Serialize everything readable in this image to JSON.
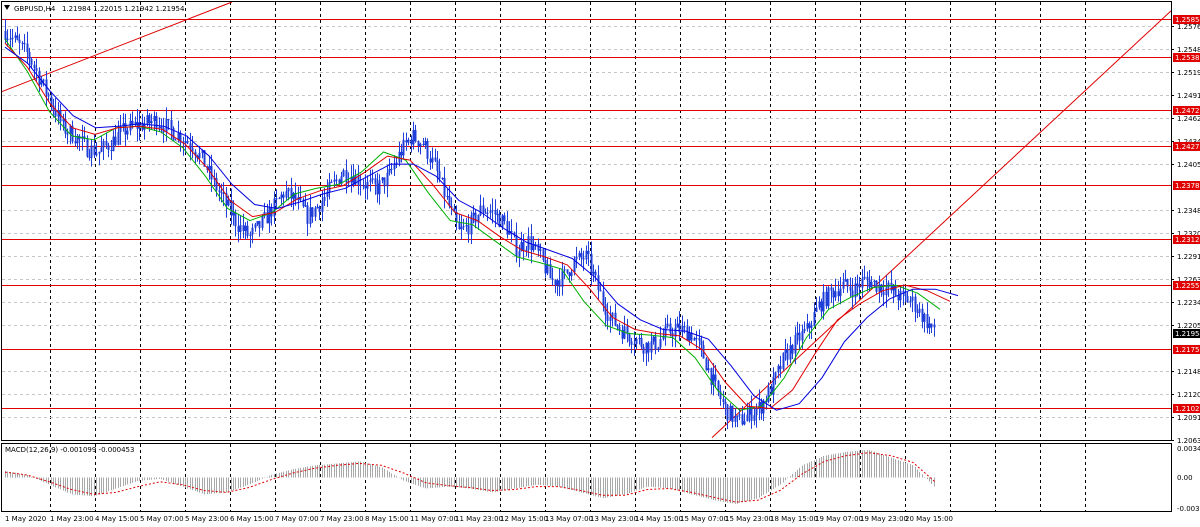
{
  "header": {
    "symbol": "GBPUSD,H4",
    "values": "1.21984 1.22015 1.21942 1.21954",
    "indicator_label": "MACD(12,26,9) -0.001099 -0.000453"
  },
  "colors": {
    "candle": "#1f3fd8",
    "ma_fast": "#00b000",
    "ma_mid": "#e00000",
    "ma_slow": "#0000e0",
    "level_line": "#e00000",
    "level_tag": "#e00000",
    "current_tag": "#000000",
    "macd_hist": "#a8a8a8",
    "macd_signal": "#e00000"
  },
  "chart_data": {
    "type": "candlestick",
    "symbol": "GBPUSD",
    "timeframe": "H4",
    "ylim": [
      1.2063,
      1.2606
    ],
    "y_ticks": [
      "1.25765",
      "1.25480",
      "1.25195",
      "1.24910",
      "1.24625",
      "1.24340",
      "1.24055",
      "1.23485",
      "1.23200",
      "1.22915",
      "1.22630",
      "1.22340",
      "1.22055",
      "1.21485",
      "1.21200",
      "1.20915",
      "1.20630"
    ],
    "x_ticks": [
      "1 May 2020",
      "1 May 23:00",
      "4 May 15:00",
      "5 May 07:00",
      "5 May 23:00",
      "6 May 15:00",
      "7 May 07:00",
      "7 May 23:00",
      "8 May 15:00",
      "11 May 07:00",
      "11 May 23:00",
      "12 May 15:00",
      "13 May 07:00",
      "13 May 23:00",
      "14 May 15:00",
      "15 May 07:00",
      "15 May 23:00",
      "18 May 15:00",
      "19 May 07:00",
      "19 May 23:00",
      "20 May 15:00"
    ],
    "current_price": "1.21954",
    "levels": [
      "1.25854",
      "1.25382",
      "1.24727",
      "1.24275",
      "1.23787",
      "1.23124",
      "1.22555",
      "1.21759",
      "1.21029"
    ],
    "price_path": [
      1.257,
      1.2555,
      1.254,
      1.251,
      1.248,
      1.245,
      1.244,
      1.2425,
      1.242,
      1.243,
      1.2445,
      1.2452,
      1.2455,
      1.246,
      1.245,
      1.244,
      1.243,
      1.241,
      1.238,
      1.2355,
      1.233,
      1.2315,
      1.233,
      1.235,
      1.237,
      1.236,
      1.234,
      1.2355,
      1.2375,
      1.2395,
      1.239,
      1.238,
      1.2375,
      1.239,
      1.242,
      1.244,
      1.243,
      1.24,
      1.236,
      1.232,
      1.233,
      1.235,
      1.2345,
      1.233,
      1.23,
      1.231,
      1.229,
      1.226,
      1.2265,
      1.2285,
      1.229,
      1.225,
      1.2215,
      1.22,
      1.219,
      1.218,
      1.2182,
      1.2198,
      1.22,
      1.2195,
      1.217,
      1.213,
      1.21,
      1.2085,
      1.2095,
      1.2105,
      1.213,
      1.2165,
      1.2185,
      1.22,
      1.223,
      1.2245,
      1.2255,
      1.225,
      1.2262,
      1.2255,
      1.225,
      1.224,
      1.2235,
      1.2215,
      1.2195
    ],
    "ma_fast_path": [
      1.256,
      1.252,
      1.247,
      1.244,
      1.2435,
      1.245,
      1.2452,
      1.2445,
      1.2425,
      1.239,
      1.235,
      1.2335,
      1.2345,
      1.2368,
      1.2375,
      1.238,
      1.2395,
      1.242,
      1.241,
      1.237,
      1.2335,
      1.233,
      1.231,
      1.229,
      1.2283,
      1.2275,
      1.2235,
      1.2205,
      1.2195,
      1.2193,
      1.219,
      1.2165,
      1.2125,
      1.21,
      1.2105,
      1.214,
      1.219,
      1.2225,
      1.224,
      1.2252,
      1.2255,
      1.2245,
      1.2225
    ],
    "ma_mid_path": [
      1.2555,
      1.2525,
      1.248,
      1.245,
      1.2442,
      1.245,
      1.2452,
      1.2448,
      1.243,
      1.24,
      1.236,
      1.234,
      1.2345,
      1.2362,
      1.2372,
      1.2378,
      1.2395,
      1.2415,
      1.241,
      1.238,
      1.2345,
      1.2335,
      1.2315,
      1.2298,
      1.229,
      1.228,
      1.225,
      1.2215,
      1.22,
      1.2195,
      1.2192,
      1.2175,
      1.2135,
      1.2105,
      1.2102,
      1.2125,
      1.217,
      1.2212,
      1.2232,
      1.2248,
      1.2255,
      1.2248,
      1.2235
    ],
    "ma_slow_path": [
      1.255,
      1.253,
      1.2495,
      1.2465,
      1.245,
      1.2452,
      1.2455,
      1.2452,
      1.244,
      1.2415,
      1.238,
      1.2355,
      1.235,
      1.2358,
      1.2368,
      1.2375,
      1.239,
      1.2405,
      1.2405,
      1.239,
      1.236,
      1.2345,
      1.2325,
      1.2308,
      1.2298,
      1.2288,
      1.2265,
      1.2232,
      1.2212,
      1.22,
      1.2198,
      1.2188,
      1.2155,
      1.2118,
      1.21,
      1.2108,
      1.214,
      1.2185,
      1.2215,
      1.2238,
      1.225,
      1.225,
      1.2242
    ],
    "macd": {
      "label": "MACD(12,26,9)",
      "main": -0.001099,
      "signal": -0.000453,
      "ylim": [
        -0.00352,
        0.0034
      ],
      "y_ticks": [
        "0.003401",
        "0.00",
        "-0.00352"
      ],
      "hist_path": [
        0.0006,
        0.0002,
        -0.0008,
        -0.0018,
        -0.002,
        -0.0012,
        -0.0004,
        -0.0002,
        -0.001,
        -0.0018,
        -0.0016,
        -0.0008,
        0.0002,
        0.0008,
        0.0012,
        0.0014,
        0.0016,
        0.001,
        -0.0004,
        -0.0012,
        -0.001,
        -0.0012,
        -0.0016,
        -0.0012,
        -0.0008,
        -0.001,
        -0.0016,
        -0.0022,
        -0.0018,
        -0.001,
        -0.0012,
        -0.0018,
        -0.0024,
        -0.0028,
        -0.0022,
        -0.0008,
        0.0012,
        0.0022,
        0.0026,
        0.0028,
        0.002,
        0.0012,
        -0.0011
      ],
      "signal_path": [
        0.0005,
        0.0002,
        -0.0005,
        -0.0013,
        -0.0018,
        -0.0016,
        -0.001,
        -0.0005,
        -0.0008,
        -0.0014,
        -0.0016,
        -0.0011,
        -0.0003,
        0.0004,
        0.0009,
        0.0012,
        0.0014,
        0.0012,
        0.0004,
        -0.0006,
        -0.0009,
        -0.0011,
        -0.0014,
        -0.0013,
        -0.001,
        -0.001,
        -0.0014,
        -0.0019,
        -0.0019,
        -0.0013,
        -0.0012,
        -0.0016,
        -0.0021,
        -0.0026,
        -0.0024,
        -0.0014,
        0.0003,
        0.0016,
        0.0022,
        0.0025,
        0.0022,
        0.0015,
        -0.0005
      ]
    }
  }
}
